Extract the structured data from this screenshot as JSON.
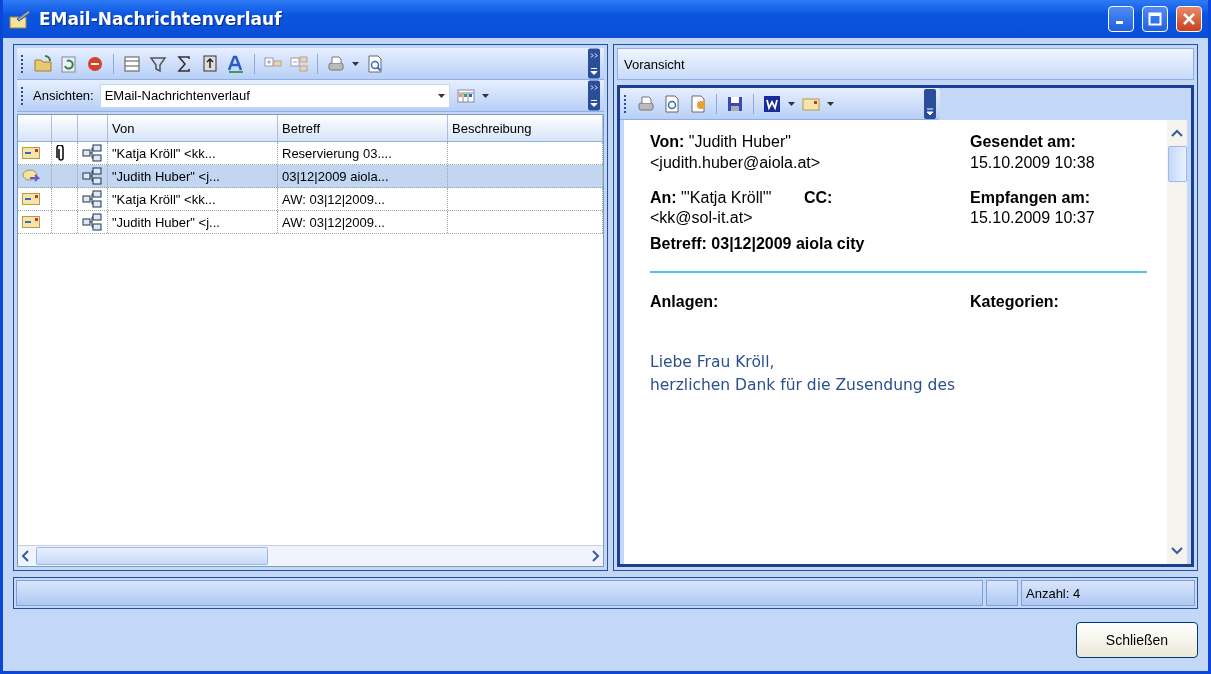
{
  "window": {
    "title": "EMail-Nachrichtenverlauf"
  },
  "views": {
    "label": "Ansichten:",
    "value": "EMail-Nachrichtenverlauf"
  },
  "table": {
    "columns": [
      "Von",
      "Betreff",
      "Beschreibung"
    ],
    "rows": [
      {
        "kind": "mail",
        "attachment": true,
        "from": "\"Katja Kröll\" <kk...",
        "subject": "Reservierung 03....",
        "selected": false
      },
      {
        "kind": "forwarded",
        "attachment": false,
        "from": "\"Judith Huber\" <j...",
        "subject": "03|12|2009 aiola...",
        "selected": true
      },
      {
        "kind": "mail",
        "attachment": false,
        "from": "\"Katja Kröll\" <kk...",
        "subject": "AW: 03|12|2009...",
        "selected": false
      },
      {
        "kind": "mail",
        "attachment": false,
        "from": "\"Judith Huber\" <j...",
        "subject": "AW: 03|12|2009...",
        "selected": false
      }
    ]
  },
  "preview": {
    "title": "Voransicht",
    "from": "**Von:** \"Judith Huber\" <judith.huber@aiola.at>",
    "sent": "**Gesendet am:** 15.10.2009 10:38",
    "to": "**An:** \"'Katja Kröll'\" <kk@sol-it.at>",
    "cc": "CC:",
    "received": "**Empfangen am:** 15.10.2009 10:37",
    "subject": "Betreff: 03|12|2009 aiola city",
    "attachments": "Anlagen:",
    "categories": "Kategorien:",
    "body": [
      "Liebe Frau Kröll,",
      "herzlichen Dank für die Zusendung des"
    ]
  },
  "status_bar": {
    "count": "Anzahl: 4"
  },
  "buttons": [
    "Schließen"
  ]
}
